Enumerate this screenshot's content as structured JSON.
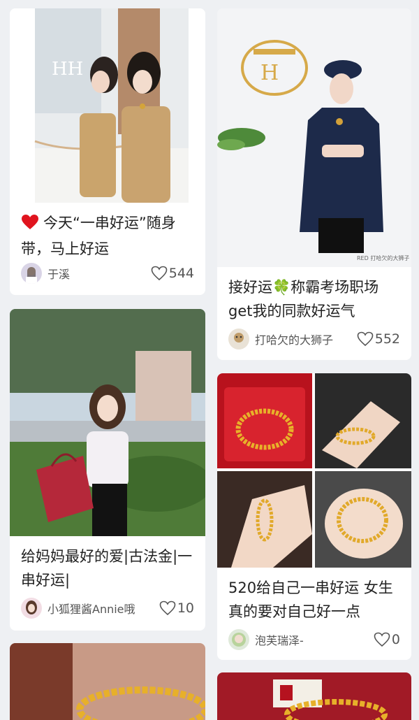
{
  "posts": [
    {
      "title": "今天“一串好运”随身带，马上好运",
      "author": "于溪",
      "likes": "544"
    },
    {
      "title": "接好运🍀称霸考场职场get我的同款好运气",
      "author": "打哈欠的大狮子",
      "likes": "552",
      "watermark": "RED 打哈欠的大狮子"
    },
    {
      "title": "给妈妈最好的爱|古法金|一串好运|",
      "author": "小狐狸酱Annie哦",
      "likes": "10"
    },
    {
      "title": "520给自己一串好运 女生真的要对自己好一点",
      "author": "泡芙瑞泽-",
      "likes": "0"
    }
  ],
  "icons": {
    "heart_emoji": "heart-emoji-icon",
    "like": "heart-outline-icon",
    "clover": "four-leaf-clover-icon"
  },
  "colors": {
    "background": "#eef0f3",
    "card": "#ffffff",
    "text": "#222222",
    "heart": "#e0141e"
  }
}
